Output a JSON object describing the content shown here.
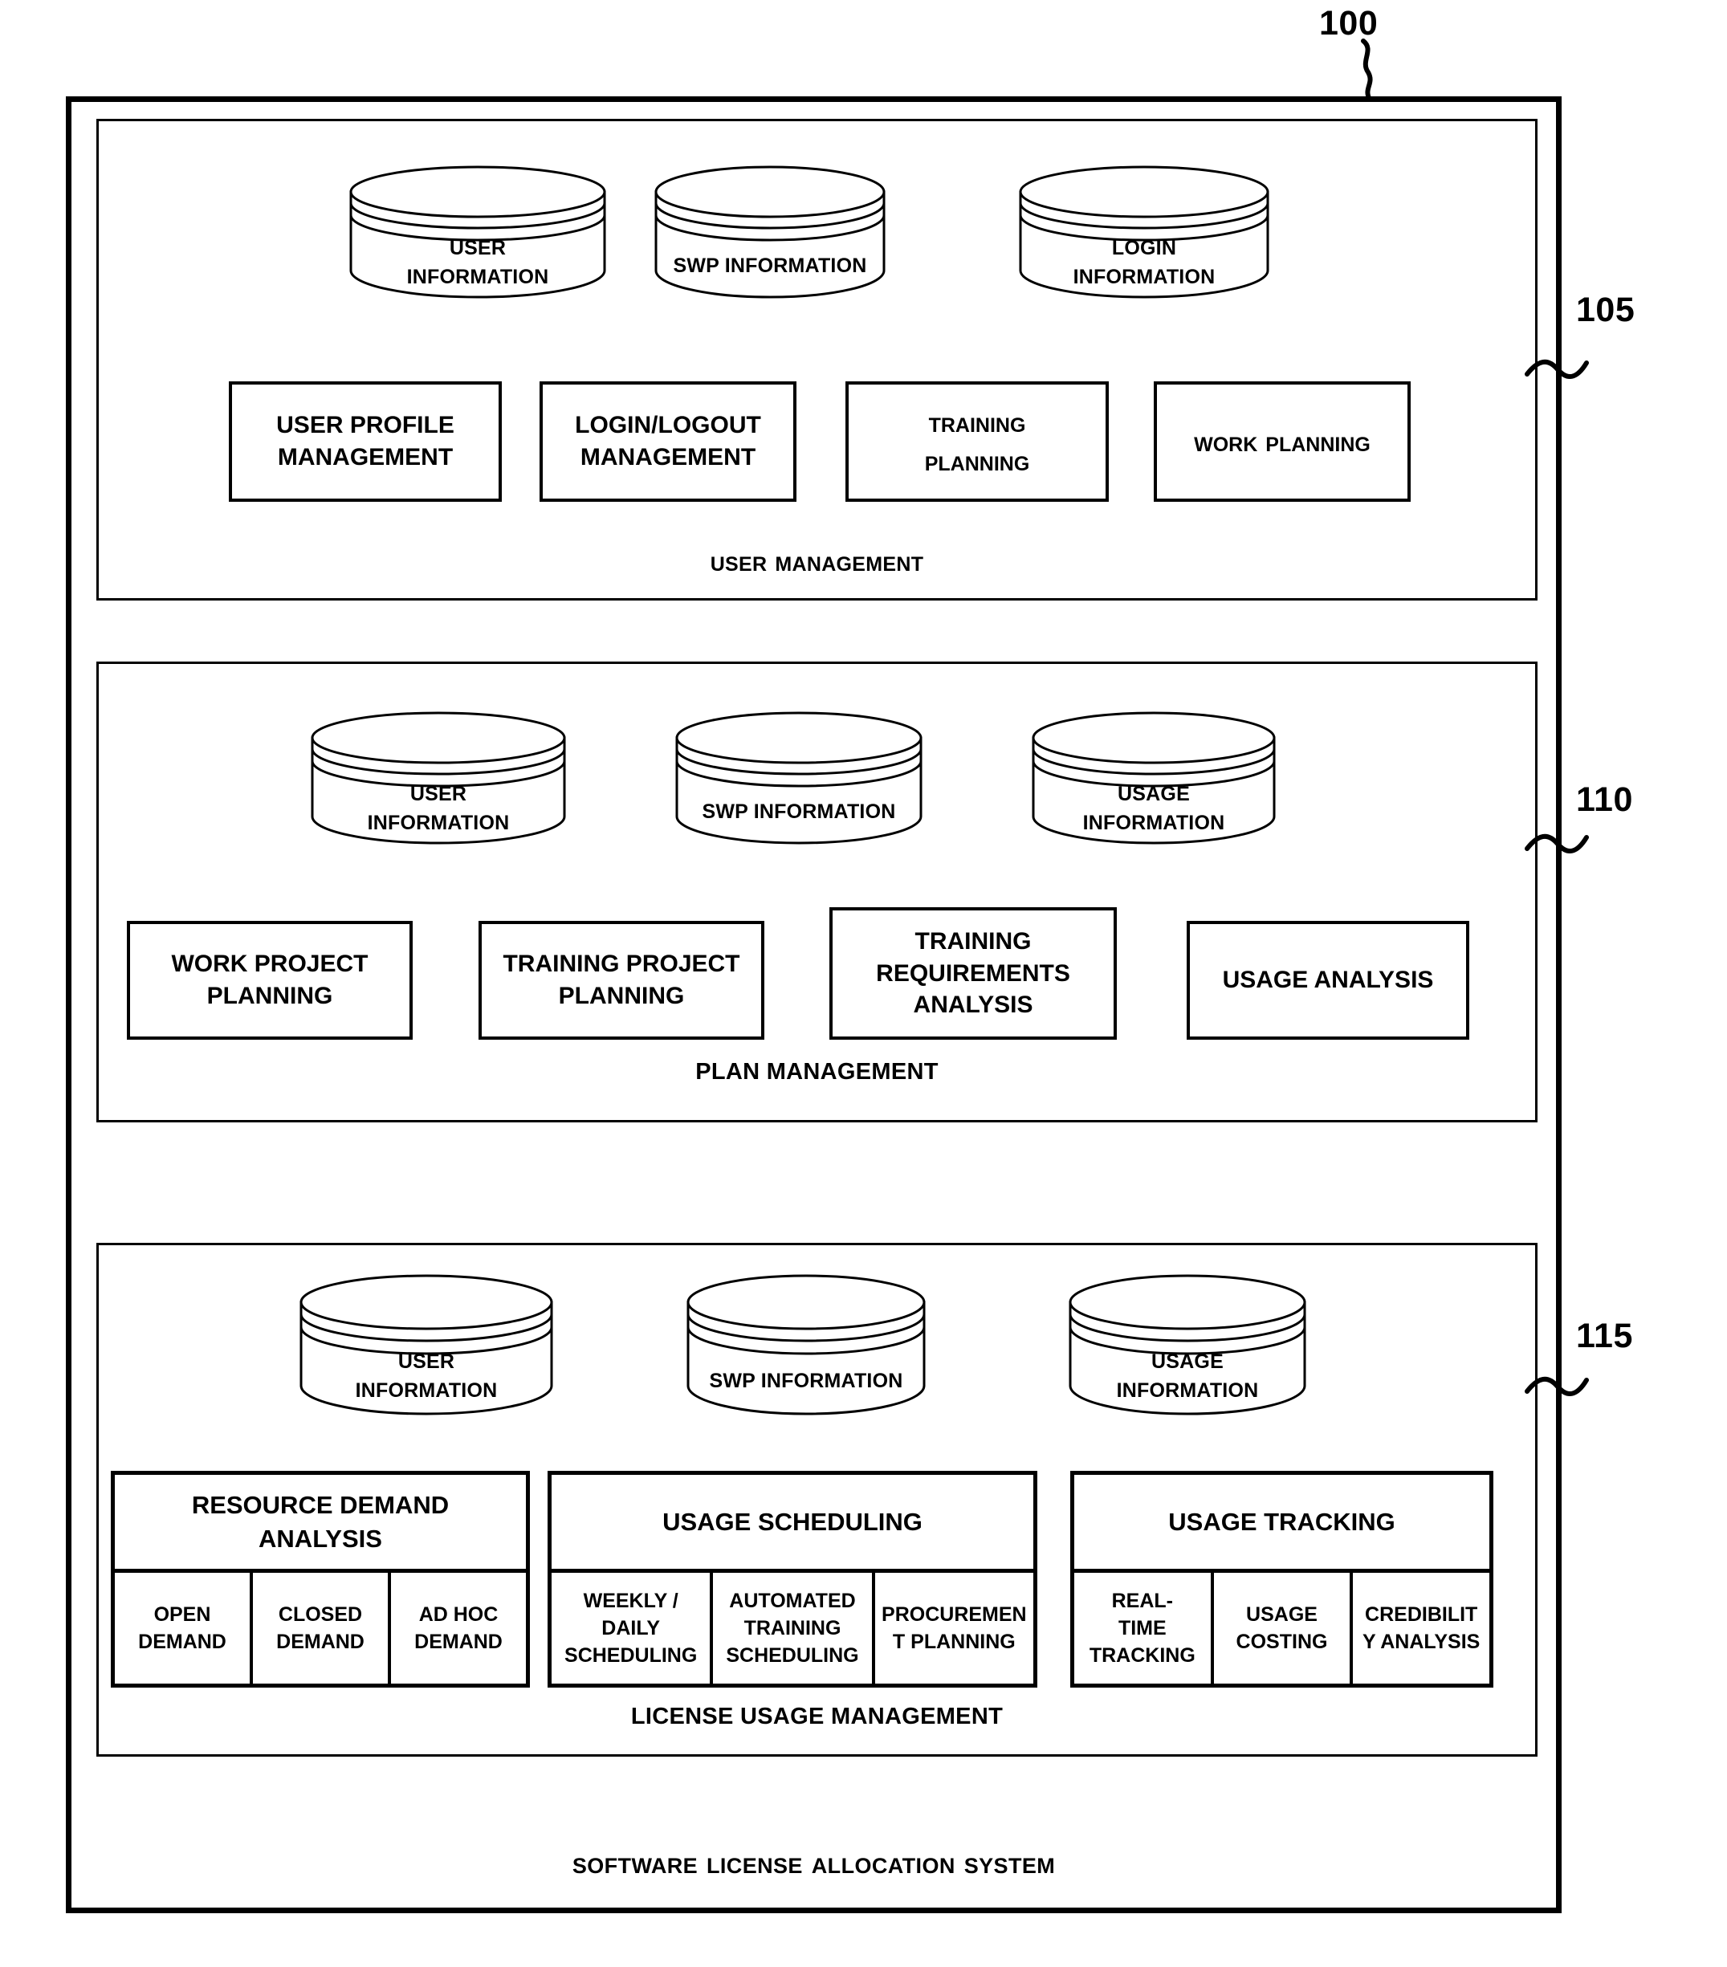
{
  "figure": {
    "system_ref": "100",
    "system_caption": "Software License Allocation System"
  },
  "modules": [
    {
      "ref": "105",
      "caption": "User management",
      "caption_style": "smallcaps",
      "databases": [
        {
          "icon": "database-cylinder-icon",
          "lines": [
            "USER",
            "INFORMATION"
          ]
        },
        {
          "icon": "database-cylinder-icon",
          "lines": [
            "SWP  INFORMATION"
          ]
        },
        {
          "icon": "database-cylinder-icon",
          "lines": [
            "LOGIN",
            "INFORMATION"
          ]
        }
      ],
      "functions": [
        {
          "lines": [
            "USER PROFILE",
            "MANAGEMENT"
          ],
          "style": "caps"
        },
        {
          "lines": [
            "LOGIN/LOGOUT",
            "MANAGEMENT"
          ],
          "style": "caps"
        },
        {
          "lines": [
            "Training",
            "Planning"
          ],
          "style": "smallcaps"
        },
        {
          "lines": [
            "Work Planning"
          ],
          "style": "smallcaps"
        }
      ]
    },
    {
      "ref": "110",
      "caption": "PLAN MANAGEMENT",
      "caption_style": "caps",
      "databases": [
        {
          "icon": "database-cylinder-icon",
          "lines": [
            "USER",
            "INFORMATION"
          ]
        },
        {
          "icon": "database-cylinder-icon",
          "lines": [
            "SWP INFORMATION"
          ]
        },
        {
          "icon": "database-cylinder-icon",
          "lines": [
            "USAGE",
            "INFORMATION"
          ]
        }
      ],
      "functions": [
        {
          "lines": [
            "WORK PROJECT",
            "PLANNING"
          ],
          "style": "caps"
        },
        {
          "lines": [
            "TRAINING PROJECT",
            "PLANNING"
          ],
          "style": "caps"
        },
        {
          "lines": [
            "TRAINING",
            "REQUIREMENTS",
            "ANALYSIS"
          ],
          "style": "caps"
        },
        {
          "lines": [
            "USAGE ANALYSIS"
          ],
          "style": "caps"
        }
      ]
    },
    {
      "ref": "115",
      "caption": "LICENSE USAGE MANAGEMENT",
      "caption_style": "caps",
      "databases": [
        {
          "icon": "database-cylinder-icon",
          "lines": [
            "USER",
            "INFORMATION"
          ]
        },
        {
          "icon": "database-cylinder-icon",
          "lines": [
            "SWP INFORMATION"
          ]
        },
        {
          "icon": "database-cylinder-icon",
          "lines": [
            "USAGE",
            "INFORMATION"
          ]
        }
      ],
      "groups": [
        {
          "title_lines": [
            "RESOURCE DEMAND",
            "ANALYSIS"
          ],
          "cells": [
            {
              "lines": [
                "OPEN",
                "DEMAND"
              ]
            },
            {
              "lines": [
                "CLOSED",
                "DEMAND"
              ]
            },
            {
              "lines": [
                "AD HOC",
                "DEMAND"
              ]
            }
          ]
        },
        {
          "title_lines": [
            "USAGE SCHEDULING"
          ],
          "cells": [
            {
              "lines": [
                "WEEKLY /",
                "DAILY",
                "SCHEDULING"
              ]
            },
            {
              "lines": [
                "AUTOMATED",
                "TRAINING",
                "SCHEDULING"
              ]
            },
            {
              "lines": [
                "PROCUREMEN",
                "T PLANNING"
              ]
            }
          ]
        },
        {
          "title_lines": [
            "USAGE TRACKING"
          ],
          "cells": [
            {
              "lines": [
                "REAL-",
                "TIME",
                "TRACKING"
              ]
            },
            {
              "lines": [
                "USAGE",
                "COSTING"
              ]
            },
            {
              "lines": [
                "CREDIBILIT",
                "Y ANALYSIS"
              ]
            }
          ]
        }
      ]
    }
  ],
  "colors": {
    "ink": "#000000",
    "paper": "#ffffff"
  }
}
